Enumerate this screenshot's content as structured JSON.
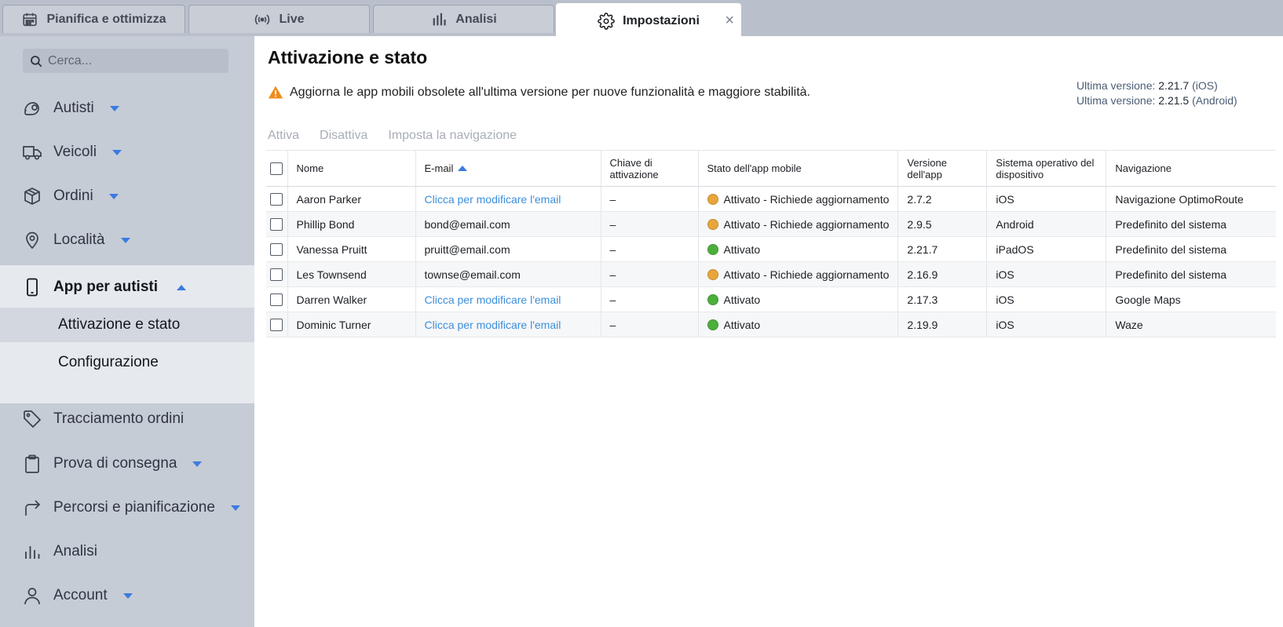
{
  "tabs": [
    {
      "label": "Pianifica e ottimizza",
      "icon": "calendar-icon"
    },
    {
      "label": "Live",
      "icon": "broadcast-icon"
    },
    {
      "label": "Analisi",
      "icon": "bar-chart-icon"
    },
    {
      "label": "Impostazioni",
      "icon": "gear-icon",
      "active": true
    }
  ],
  "tab_close": "×",
  "sidebar": {
    "search_placeholder": "Cerca...",
    "items": [
      {
        "label": "Autisti",
        "icon": "drivers-icon",
        "has_dropdown": true
      },
      {
        "label": "Veicoli",
        "icon": "truck-icon",
        "has_dropdown": true
      },
      {
        "label": "Ordini",
        "icon": "box-icon",
        "has_dropdown": true
      },
      {
        "label": "Località",
        "icon": "location-pin-icon",
        "has_dropdown": true
      },
      {
        "label": "App per autisti",
        "icon": "mobile-phone-icon",
        "expanded": true
      },
      {
        "label": "Tracciamento ordini",
        "icon": "tag-icon"
      },
      {
        "label": "Prova di consegna",
        "icon": "clipboard-icon",
        "has_dropdown": true
      },
      {
        "label": "Percorsi e pianificazione",
        "icon": "route-arrow-icon",
        "has_dropdown": true
      },
      {
        "label": "Analisi",
        "icon": "bar-chart-icon"
      },
      {
        "label": "Account",
        "icon": "user-icon",
        "has_dropdown": true
      }
    ],
    "sub_items": [
      {
        "label": "Attivazione e stato",
        "selected": true
      },
      {
        "label": "Configurazione"
      }
    ]
  },
  "main": {
    "title": "Attivazione e stato",
    "warning": "Aggiorna le app mobili obsolete all'ultima versione per nuove funzionalità e maggiore stabilità.",
    "versions": [
      {
        "label": "Ultima versione:",
        "number": "2.21.7",
        "platform": "(iOS)"
      },
      {
        "label": "Ultima versione:",
        "number": "2.21.5",
        "platform": "(Android)"
      }
    ],
    "actions": [
      "Attiva",
      "Disattiva",
      "Imposta la navigazione"
    ],
    "table": {
      "headers": [
        "Nome",
        "E-mail",
        "Chiave di attivazione",
        "Stato dell'app mobile",
        "Versione dell'app",
        "Sistema operativo del dispositivo",
        "Navigazione"
      ],
      "sorted_column": "E-mail",
      "sort_direction": "ascending",
      "rows": [
        {
          "name": "Aaron Parker",
          "email": "Clicca per modificare l'email",
          "email_is_link": true,
          "key": "–",
          "status": "Attivato - Richiede aggiornamento",
          "status_color": "#e8a63a",
          "version": "2.7.2",
          "os": "iOS",
          "nav": "Navigazione OptimoRoute"
        },
        {
          "name": "Phillip Bond",
          "email": "bond@email.com",
          "email_is_link": false,
          "key": "–",
          "status": "Attivato - Richiede aggiornamento",
          "status_color": "#e8a63a",
          "version": "2.9.5",
          "os": "Android",
          "nav": "Predefinito del sistema"
        },
        {
          "name": "Vanessa Pruitt",
          "email": "pruitt@email.com",
          "email_is_link": false,
          "key": "–",
          "status": "Attivato",
          "status_color": "#4caf3c",
          "version": "2.21.7",
          "os": "iPadOS",
          "nav": "Predefinito del sistema"
        },
        {
          "name": "Les Townsend",
          "email": "townse@email.com",
          "email_is_link": false,
          "key": "–",
          "status": "Attivato - Richiede aggiornamento",
          "status_color": "#e8a63a",
          "version": "2.16.9",
          "os": "iOS",
          "nav": "Predefinito del sistema"
        },
        {
          "name": "Darren Walker",
          "email": "Clicca per modificare l'email",
          "email_is_link": true,
          "key": "–",
          "status": "Attivato",
          "status_color": "#4caf3c",
          "version": "2.17.3",
          "os": "iOS",
          "nav": "Google Maps"
        },
        {
          "name": "Dominic Turner",
          "email": "Clicca per modificare l'email",
          "email_is_link": true,
          "key": "–",
          "status": "Attivato",
          "status_color": "#4caf3c",
          "version": "2.19.9",
          "os": "iOS",
          "nav": "Waze"
        }
      ]
    }
  },
  "colors": {
    "accent": "#3b7be0",
    "link": "#3d8fdc",
    "warning": "#f08c1c"
  }
}
